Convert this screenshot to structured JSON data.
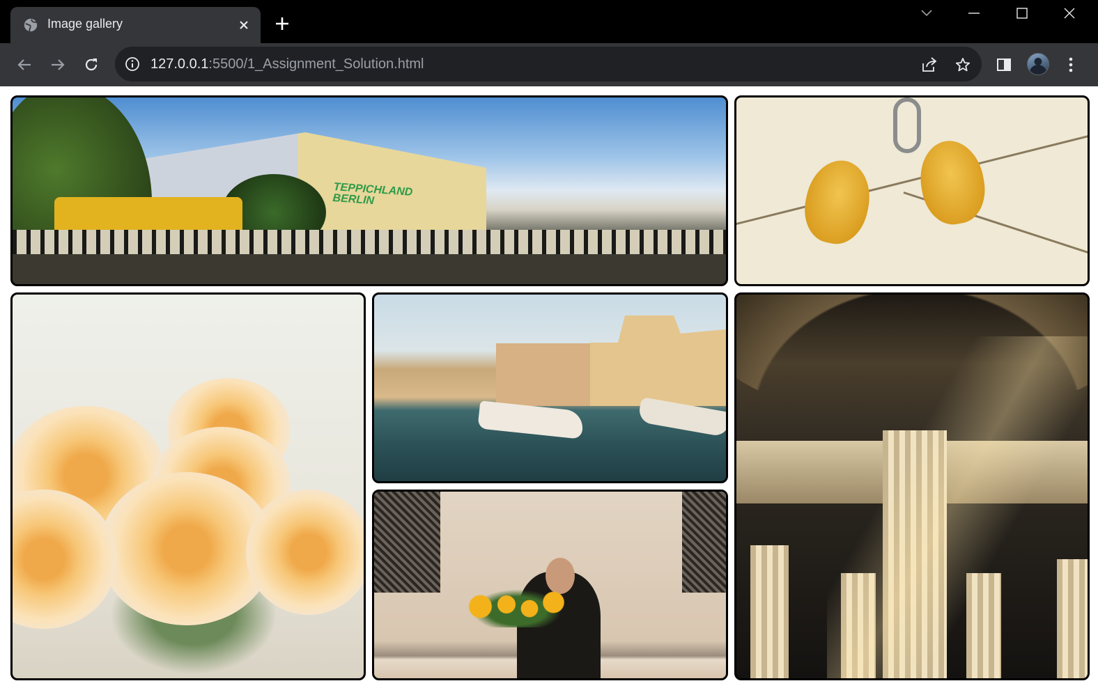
{
  "browser": {
    "tab_title": "Image gallery",
    "url_host": "127.0.0.1",
    "url_rest": ":5500/1_Assignment_Solution.html"
  },
  "icons": {
    "tab": "globe-icon",
    "close": "close-icon",
    "new_tab": "plus-icon",
    "back": "arrow-left-icon",
    "forward": "arrow-right-icon",
    "reload": "reload-icon",
    "info": "info-icon",
    "share": "share-icon",
    "bookmark": "star-icon",
    "side_panel": "side-panel-icon",
    "menu": "kebab-menu-icon"
  },
  "colors": {
    "titlebar": "#000000",
    "toolbar": "#35363a",
    "omnibox": "#202124",
    "photo_border": "#000000"
  },
  "gallery": {
    "photos": [
      {
        "id": "berlin",
        "subject": "yellow train on elevated bridge"
      },
      {
        "id": "birds",
        "subject": "two yellow canaries on a wire"
      },
      {
        "id": "roses",
        "subject": "peach garden roses"
      },
      {
        "id": "venice",
        "subject": "boats on a Venice canal"
      },
      {
        "id": "woman",
        "subject": "woman holding sunflowers"
      },
      {
        "id": "columns",
        "subject": "classical columns in sunlight"
      }
    ],
    "berlin_sign_line1": "TEPPICHLAND",
    "berlin_sign_line2": "BERLIN"
  }
}
